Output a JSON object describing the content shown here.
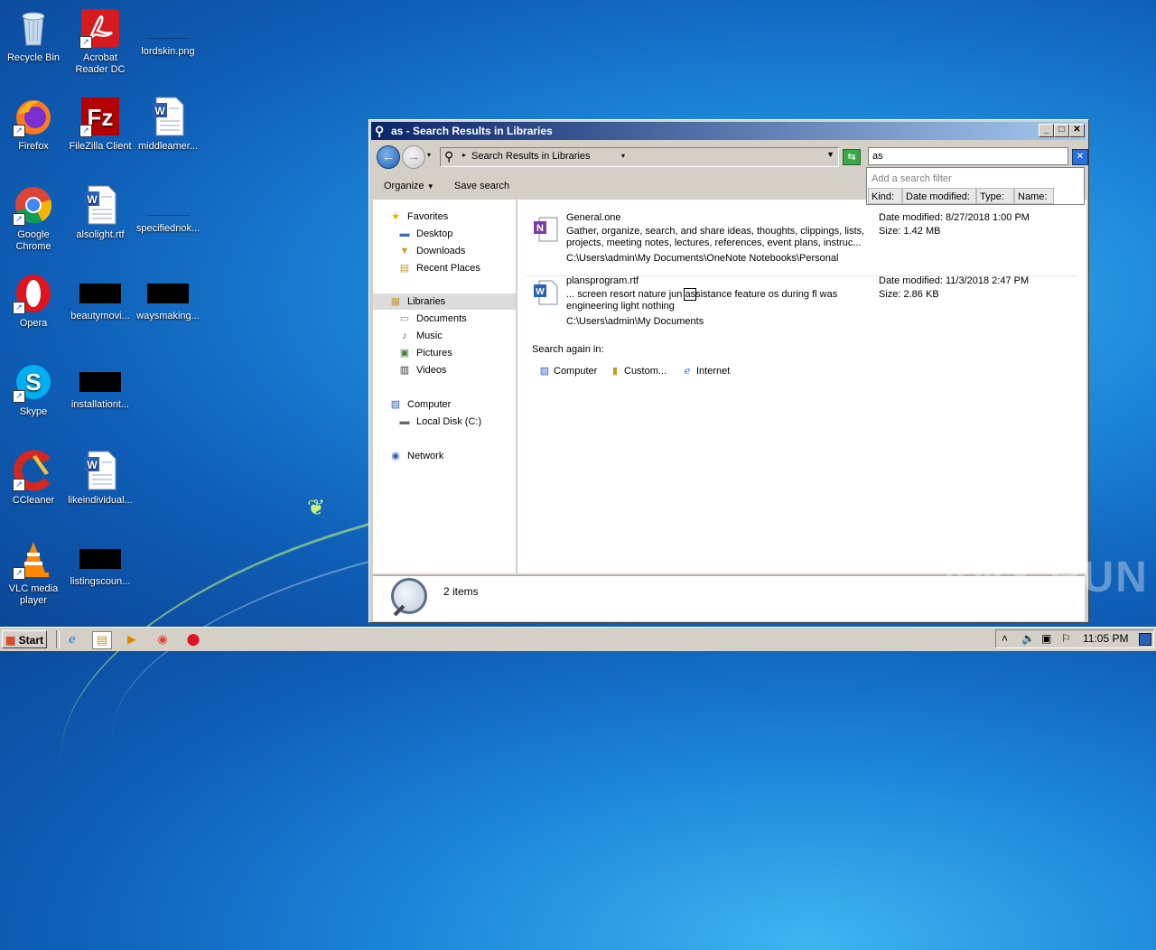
{
  "desktop": {
    "icons": [
      {
        "label": "Recycle Bin"
      },
      {
        "label": "Acrobat Reader DC"
      },
      {
        "label": "lordskin.png"
      },
      {
        "label": "Firefox"
      },
      {
        "label": "FileZilla Client"
      },
      {
        "label": "middleamer..."
      },
      {
        "label": "Google Chrome"
      },
      {
        "label": "alsolight.rtf"
      },
      {
        "label": "specifiednok..."
      },
      {
        "label": "Opera"
      },
      {
        "label": "beautymovi..."
      },
      {
        "label": "waysmaking..."
      },
      {
        "label": "Skype"
      },
      {
        "label": "installationt..."
      },
      {
        "label": "CCleaner"
      },
      {
        "label": "likeindividual..."
      },
      {
        "label": "VLC media player"
      },
      {
        "label": "listingscoun..."
      }
    ]
  },
  "window": {
    "title": "as - Search Results in Libraries",
    "address": "Search Results in Libraries",
    "search_value": "as",
    "filter": {
      "placeholder": "Add a search filter",
      "chips": [
        "Kind:",
        "Date modified:",
        "Type:",
        "Name:"
      ]
    },
    "toolbar": {
      "organize": "Organize",
      "save_search": "Save search"
    },
    "nav": {
      "favorites": "Favorites",
      "desktop": "Desktop",
      "downloads": "Downloads",
      "recent_places": "Recent Places",
      "libraries": "Libraries",
      "documents": "Documents",
      "music": "Music",
      "pictures": "Pictures",
      "videos": "Videos",
      "computer": "Computer",
      "local_disk": "Local Disk (C:)",
      "network": "Network"
    },
    "results": [
      {
        "name": "General.one",
        "snippet_1": "Gather, organize, search, and share ideas, thoughts, clippings, lists,",
        "snippet_2": "projects, meeting notes, lectures, references, event plans, instruc...",
        "path": "C:\\Users\\admin\\My Documents\\OneNote Notebooks\\Personal",
        "date": "Date modified: 8/27/2018 1:00 PM",
        "size": "Size: 1.42 MB"
      },
      {
        "name": "plansprogram.rtf",
        "snippet_pre": "... screen resort nature jun ",
        "snippet_hit": "as",
        "snippet_post": "sistance feature os during fl was",
        "snippet_2": "engineering light nothing",
        "path": "C:\\Users\\admin\\My Documents",
        "date": "Date modified: 11/3/2018 2:47 PM",
        "size": "Size: 2.86 KB"
      }
    ],
    "search_again": "Search again in:",
    "search_locations": [
      "Computer",
      "Custom...",
      "Internet"
    ],
    "item_count": "2 items"
  },
  "taskbar": {
    "start": "Start",
    "clock": "11:05 PM"
  },
  "watermark": "ANY RUN",
  "colors": {
    "title_start": "#0a246a",
    "title_end": "#a6caf0",
    "desktop": "#1c86d8"
  }
}
